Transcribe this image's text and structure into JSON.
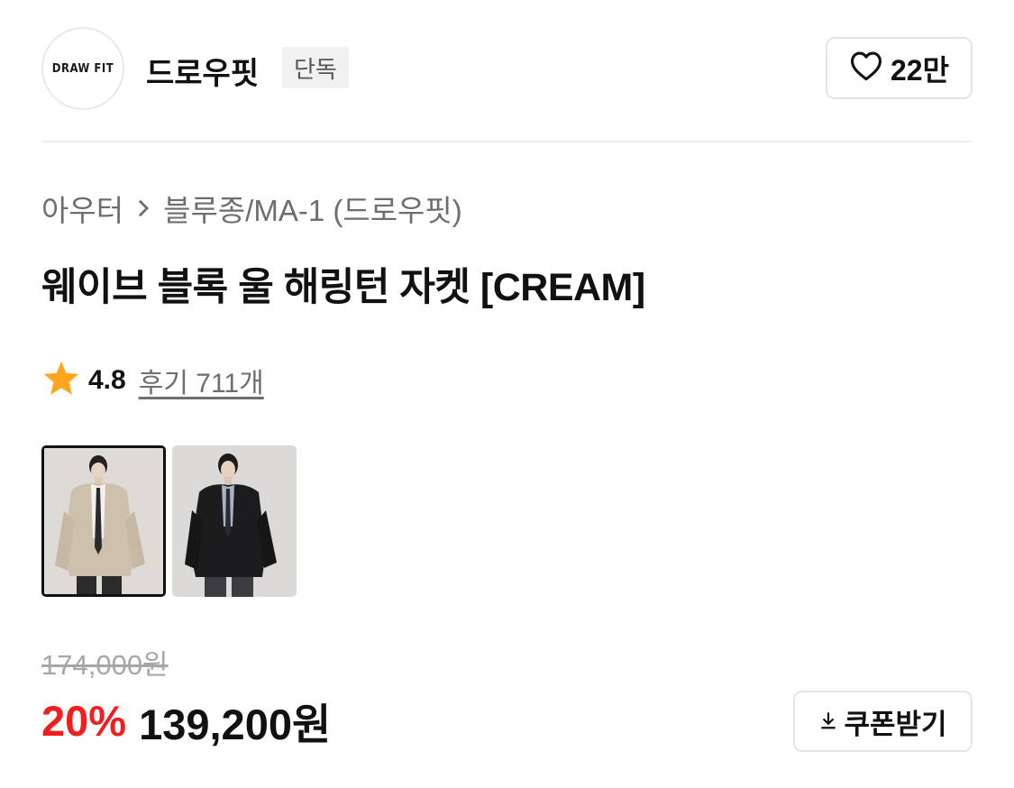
{
  "brand": {
    "logo_text": "DRAW FIT",
    "name": "드로우핏",
    "badge": "단독",
    "likes": "22만"
  },
  "breadcrumb": [
    "아우터",
    "블루종/MA-1 (드로우핏)"
  ],
  "product": {
    "title": "웨이브 블록 울 해링턴 자켓 [CREAM]"
  },
  "rating": {
    "score": "4.8",
    "reviews": "후기 711개"
  },
  "thumbnails": [
    {
      "color": "cream",
      "selected": true
    },
    {
      "color": "black",
      "selected": false
    }
  ],
  "price": {
    "original": "174,000원",
    "discount": "20%",
    "sale": "139,200원"
  },
  "coupon": {
    "label": "쿠폰받기"
  },
  "colors": {
    "discount": "#f01f1f",
    "star": "#ffa51f",
    "muted": "#6e6e6e"
  },
  "icons": [
    "heart-icon",
    "chevron-right-icon",
    "star-icon",
    "download-icon"
  ]
}
